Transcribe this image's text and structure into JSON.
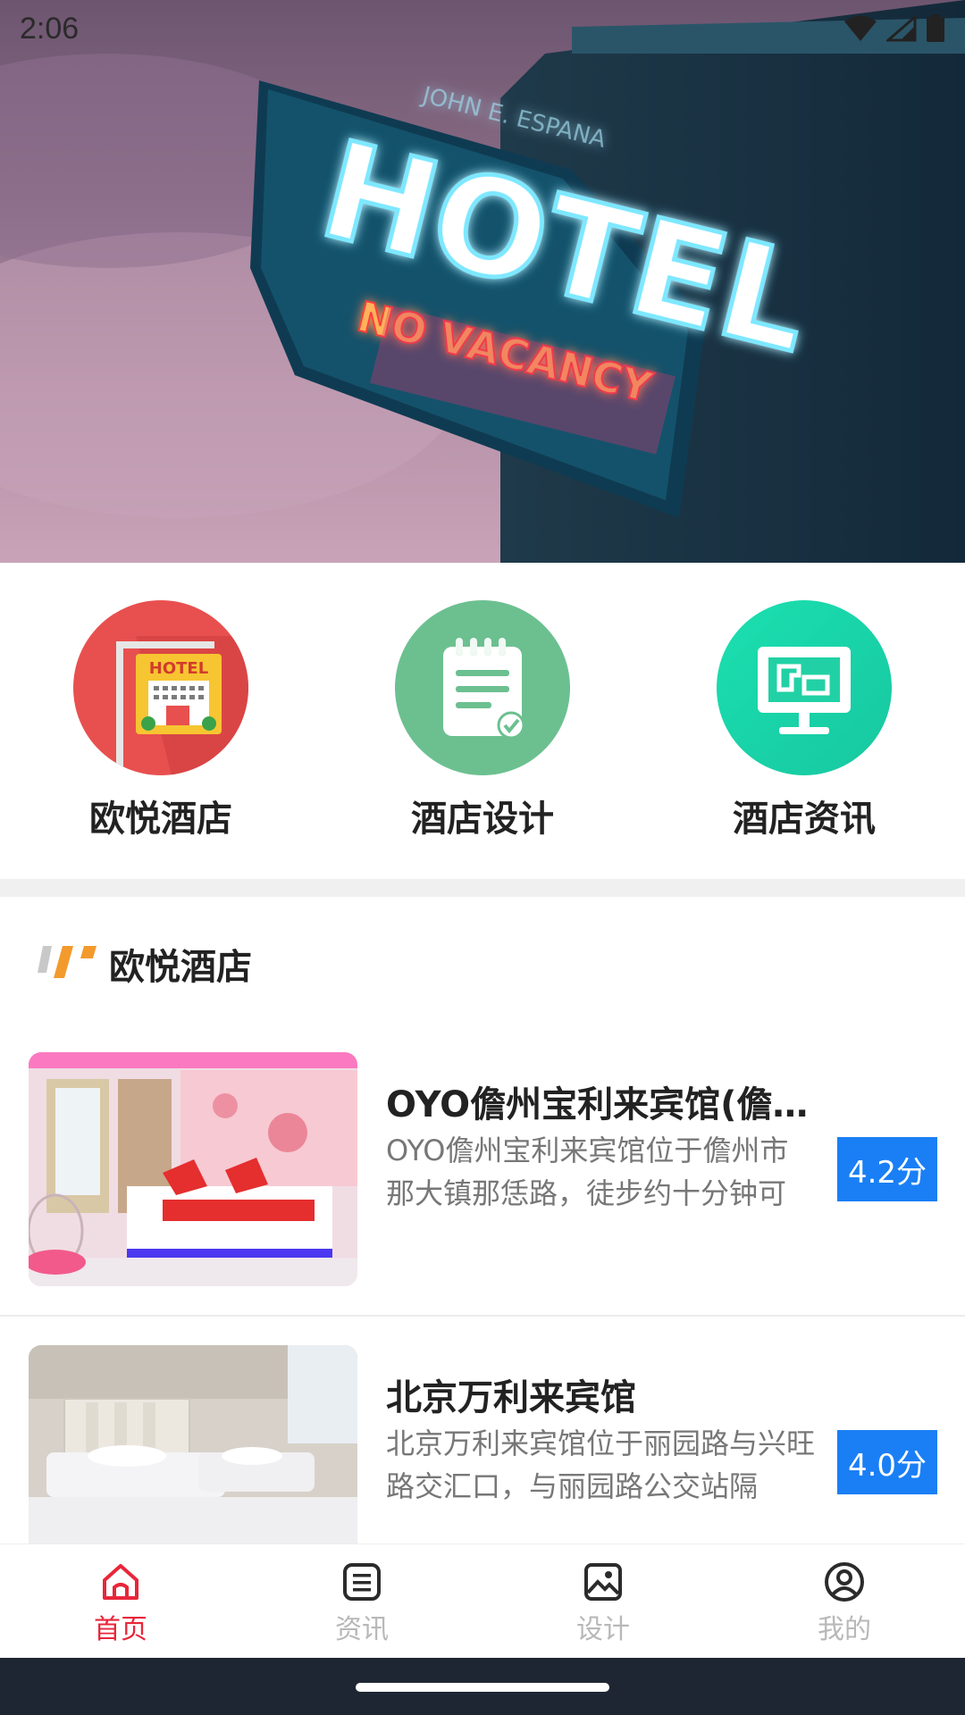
{
  "status_bar": {
    "time": "2:06"
  },
  "hero": {
    "sign_top": "HOTEL",
    "sign_bottom": "NO VACANCY",
    "sign_small": "JOHN E. ESPANA"
  },
  "categories": [
    {
      "label": "欧悦酒店",
      "icon": "hotel-sign-icon",
      "color": "#e8504f",
      "badge": "HOTEL"
    },
    {
      "label": "酒店设计",
      "icon": "notepad-icon",
      "color": "#6cc090"
    },
    {
      "label": "酒店资讯",
      "icon": "monitor-icon",
      "color": "#1fd5a6"
    }
  ],
  "section": {
    "title": "欧悦酒店"
  },
  "hotels": [
    {
      "name": "OYO儋州宝利来宾馆(儋州那大镇店)",
      "desc": "OYO儋州宝利来宾馆位于儋州市那大镇那恁路，徒步约十分钟可",
      "score": "4.2分"
    },
    {
      "name": "北京万利来宾馆",
      "desc": "北京万利来宾馆位于丽园路与兴旺路交汇口，与丽园路公交站隔",
      "score": "4.0分"
    }
  ],
  "nav": [
    {
      "label": "首页",
      "icon": "home-icon",
      "active": true
    },
    {
      "label": "资讯",
      "icon": "news-icon",
      "active": false
    },
    {
      "label": "设计",
      "icon": "image-icon",
      "active": false
    },
    {
      "label": "我的",
      "icon": "user-icon",
      "active": false
    }
  ],
  "colors": {
    "active": "#e8263a",
    "inactive": "#b8b8b8",
    "score_bg": "#1a7ff5",
    "accent_orange": "#f39a2d"
  }
}
